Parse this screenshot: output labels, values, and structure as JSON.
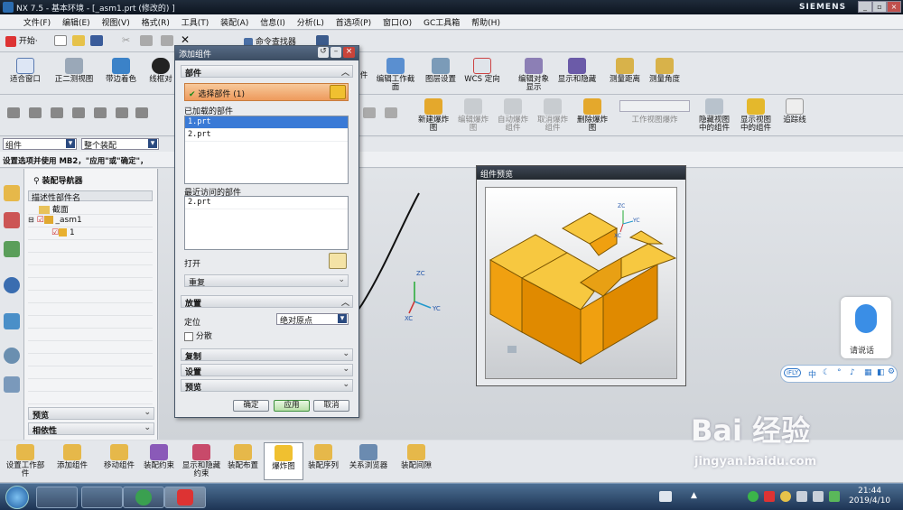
{
  "app": {
    "title": "NX 7.5 - 基本环境 - [_asm1.prt (修改的) ]",
    "brand": "SIEMENS"
  },
  "menu": [
    "文件(F)",
    "编辑(E)",
    "视图(V)",
    "格式(R)",
    "工具(T)",
    "装配(A)",
    "信息(I)",
    "分析(L)",
    "首选项(P)",
    "窗口(O)",
    "GC工具箱",
    "帮助(H)"
  ],
  "toolbar1": {
    "start": "开始·",
    "cmd_finder": "命令查找器"
  },
  "toolbar2": [
    {
      "label": "适合窗口",
      "icon": "fit-icon"
    },
    {
      "label": "正二测视图",
      "icon": "trimetric-icon"
    },
    {
      "label": "带边着色",
      "icon": "shaded-edge-icon"
    },
    {
      "label": "线框对",
      "icon": "wireframe-icon"
    },
    {
      "label": "图层设置",
      "icon": "layer-icon"
    },
    {
      "label": "WCS 定向",
      "icon": "wcs-icon"
    },
    {
      "label": "编辑对象显示",
      "icon": "edit-display-icon"
    },
    {
      "label": "显示和隐藏",
      "icon": "show-hide-icon"
    },
    {
      "label": "测量距离",
      "icon": "measure-distance-icon"
    },
    {
      "label": "测量角度",
      "icon": "measure-angle-icon"
    },
    {
      "label": "编辑工作截面",
      "icon": "section-icon"
    },
    {
      "label": "件",
      "icon": "part-icon"
    }
  ],
  "toolbar3": [
    {
      "label": "新建爆炸图"
    },
    {
      "label": "编辑爆炸图"
    },
    {
      "label": "自动爆炸组件"
    },
    {
      "label": "取消爆炸组件"
    },
    {
      "label": "删除爆炸图"
    },
    {
      "label": "工作视图爆炸"
    },
    {
      "label": "隐藏视图中的组件"
    },
    {
      "label": "显示视图中的组件"
    },
    {
      "label": "追踪线"
    }
  ],
  "filters": {
    "type": "组件",
    "scope": "整个装配"
  },
  "prompt": "设置选项并使用 MB2，\"应用\"或\"确定\"，",
  "navigator": {
    "title": "装配导航器",
    "column": "描述性部件名",
    "rows": [
      "截面",
      "_asm1",
      "1"
    ],
    "sections": [
      "预览",
      "相依性"
    ]
  },
  "dialog": {
    "title": "添加组件",
    "part_section": "部件",
    "select_part": "选择部件 (1)",
    "loaded_label": "已加载的部件",
    "loaded": [
      "1.prt",
      "2.prt"
    ],
    "recent_label": "最近访问的部件",
    "recent": [
      "2.prt"
    ],
    "open_label": "打开",
    "repeat_label": "重复",
    "placement": "放置",
    "positioning_label": "定位",
    "positioning_value": "绝对原点",
    "scatter_label": "分散",
    "copy": "复制",
    "settings": "设置",
    "preview": "预览",
    "ok": "确定",
    "apply": "应用",
    "cancel": "取消"
  },
  "preview_window": {
    "title": "组件预览"
  },
  "triad": {
    "zc": "ZC",
    "yc": "YC",
    "xc": "XC"
  },
  "bottom_toolbar": [
    {
      "label": "设置工作部件"
    },
    {
      "label": "添加组件"
    },
    {
      "label": "移动组件"
    },
    {
      "label": "装配约束"
    },
    {
      "label": "显示和隐藏约束"
    },
    {
      "label": "装配布置"
    },
    {
      "label": "爆炸图"
    },
    {
      "label": "装配序列"
    },
    {
      "label": "关系浏览器"
    },
    {
      "label": "装配间隙"
    }
  ],
  "voice": {
    "label": "请说话"
  },
  "ime": {
    "brand": "iFLY",
    "mode": "中"
  },
  "watermark": {
    "brand": "Bai 经验",
    "url": "jingyan.baidu.com"
  },
  "clock": {
    "time": "21:44",
    "date": "2019/4/10"
  },
  "colors": {
    "accent_orange": "#f0a000",
    "dialog_title": "#4a5d75",
    "select_bar": "#f2a76c"
  }
}
